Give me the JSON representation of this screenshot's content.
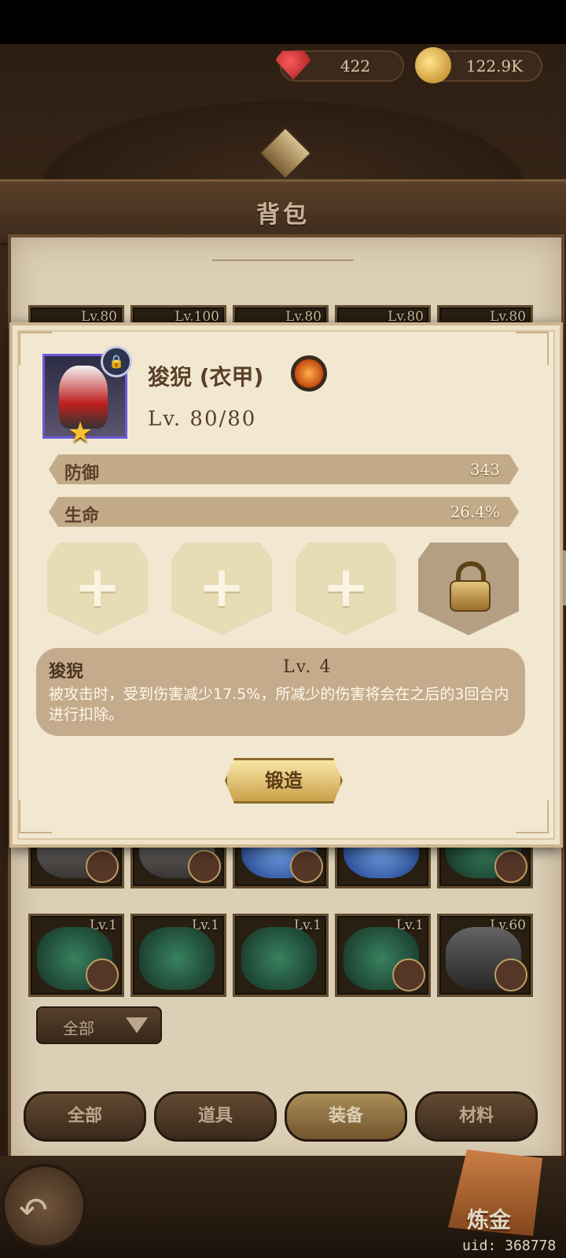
{
  "currency": {
    "gems": "422",
    "gold": "122.9K"
  },
  "header": {
    "title": "背包"
  },
  "grid": {
    "top_row_levels": [
      "Lv.80",
      "Lv.100",
      "Lv.80",
      "Lv.80",
      "Lv.80"
    ],
    "row3_levels": [
      "",
      "",
      "",
      "",
      ""
    ],
    "row4_levels": [
      "Lv.1",
      "Lv.1",
      "Lv.1",
      "Lv.1",
      "Lv.60"
    ]
  },
  "filter": {
    "label": "全部"
  },
  "tabs": [
    {
      "label": "全部",
      "active": false
    },
    {
      "label": "道具",
      "active": false
    },
    {
      "label": "装备",
      "active": true
    },
    {
      "label": "材料",
      "active": false
    }
  ],
  "alchemy_label": "炼金",
  "uid": "uid: 368778",
  "item": {
    "name": "狻猊 (衣甲)",
    "level": "Lv. 80/80",
    "stats": [
      {
        "name": "防御",
        "value": "343"
      },
      {
        "name": "生命",
        "value": "26.4%"
      }
    ],
    "sockets": [
      "empty",
      "empty",
      "empty",
      "locked"
    ],
    "skill": {
      "name": "狻猊",
      "level": "Lv. 4",
      "description": "被攻击时，受到伤害减少17.5%，所减少的伤害将会在之后的3回合内进行扣除。"
    },
    "forge_label": "锻造"
  }
}
